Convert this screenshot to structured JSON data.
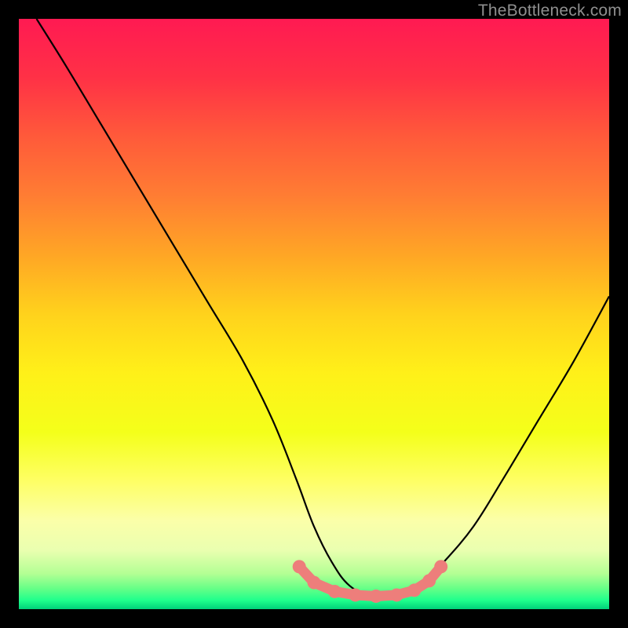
{
  "watermark": "TheBottleneck.com",
  "colors": {
    "frame": "#000000",
    "curve": "#000000",
    "marker_fill": "#ed7e7b",
    "marker_stroke": "#e46a67",
    "grad_stops": [
      {
        "offset": 0.0,
        "color": "#ff1a52"
      },
      {
        "offset": 0.1,
        "color": "#ff3146"
      },
      {
        "offset": 0.2,
        "color": "#ff5a3a"
      },
      {
        "offset": 0.3,
        "color": "#ff7d33"
      },
      {
        "offset": 0.4,
        "color": "#ffa625"
      },
      {
        "offset": 0.5,
        "color": "#ffd21c"
      },
      {
        "offset": 0.6,
        "color": "#fff019"
      },
      {
        "offset": 0.7,
        "color": "#f4ff1a"
      },
      {
        "offset": 0.78,
        "color": "#feff62"
      },
      {
        "offset": 0.85,
        "color": "#fbffa9"
      },
      {
        "offset": 0.9,
        "color": "#eaffb0"
      },
      {
        "offset": 0.94,
        "color": "#b3ff94"
      },
      {
        "offset": 0.965,
        "color": "#66ff87"
      },
      {
        "offset": 0.985,
        "color": "#1fff8c"
      },
      {
        "offset": 1.0,
        "color": "#00d17a"
      }
    ]
  },
  "chart_data": {
    "type": "line",
    "title": "",
    "xlabel": "",
    "ylabel": "",
    "xlim": [
      0,
      100
    ],
    "ylim": [
      0,
      100
    ],
    "grid": false,
    "series": [
      {
        "name": "bottleneck-curve",
        "x": [
          3,
          8,
          14,
          20,
          26,
          32,
          38,
          43,
          47,
          50,
          53,
          56,
          60,
          64,
          68,
          72,
          77,
          82,
          88,
          94,
          100
        ],
        "y": [
          100,
          92,
          82,
          72,
          62,
          52,
          42,
          32,
          22,
          14,
          8,
          4,
          2,
          2,
          4,
          8,
          14,
          22,
          32,
          42,
          53
        ]
      }
    ],
    "markers": {
      "name": "highlighted-points",
      "x": [
        47.5,
        50,
        53.5,
        57,
        60.5,
        64,
        67,
        69.5,
        71.5
      ],
      "y": [
        7.2,
        4.5,
        3.0,
        2.4,
        2.2,
        2.4,
        3.2,
        4.8,
        7.2
      ]
    }
  }
}
